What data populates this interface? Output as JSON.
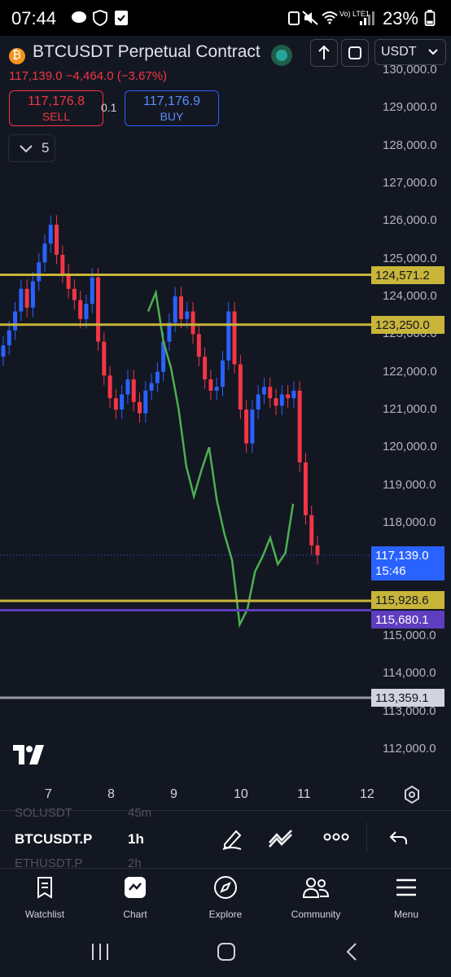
{
  "status_bar": {
    "time": "07:44",
    "battery": "23%",
    "network": "Vo) LTE1"
  },
  "header": {
    "symbol_title": "BTCUSDT Perpetual Contract",
    "currency": "USDT",
    "price_change": "117,139.0  −4,464.0 (−3.67%)"
  },
  "trade": {
    "sell_price": "117,176.8",
    "sell_label": "SELL",
    "spread": "0.1",
    "buy_price": "117,176.9",
    "buy_label": "BUY"
  },
  "indicator_toggle": {
    "count": "5"
  },
  "chart_data": {
    "type": "candlestick",
    "x_labels": [
      "7",
      "8",
      "9",
      "10",
      "11",
      "12"
    ],
    "y_ticks": [
      "130,000.0",
      "129,000.0",
      "128,000.0",
      "127,000.0",
      "126,000.0",
      "125,000.0",
      "124,000.0",
      "123,000.0",
      "122,000.0",
      "121,000.0",
      "120,000.0",
      "119,000.0",
      "118,000.0",
      "117,000.0",
      "116,000.0",
      "115,000.0",
      "114,000.0",
      "113,000.0",
      "112,000.0"
    ],
    "ylim": [
      111500,
      130500
    ],
    "price_lines": [
      {
        "value": 124571.2,
        "label": "124,571.2",
        "color": "#c8b53a"
      },
      {
        "value": 123250.0,
        "label": "123,250.0",
        "color": "#c8b53a"
      },
      {
        "value": 115928.6,
        "label": "115,928.6",
        "color": "#c8b53a"
      },
      {
        "value": 115680.1,
        "label": "115,680.1",
        "color": "#5e3dbf"
      },
      {
        "value": 113359.1,
        "label": "113,359.1",
        "color": "#9598a1"
      }
    ],
    "last_price": {
      "value": 117139.0,
      "label": "117,139.0",
      "countdown": "15:46",
      "color": "#2962ff"
    },
    "closes": [
      122700,
      123100,
      123600,
      124200,
      123700,
      124400,
      124900,
      125400,
      125900,
      125100,
      124600,
      124200,
      123900,
      123400,
      123800,
      124500,
      122800,
      121900,
      121300,
      121000,
      121400,
      121800,
      121200,
      120900,
      121500,
      121700,
      122000,
      122800,
      123300,
      124000,
      123400,
      123600,
      123000,
      122400,
      121800,
      121500,
      121600,
      122300,
      123600,
      122200,
      121000,
      120100,
      121000,
      121400,
      121600,
      121300,
      121100,
      121400,
      121300,
      121500,
      119600,
      118200,
      117400,
      117139
    ],
    "oscillator": [
      123600,
      124100,
      122800,
      122100,
      121000,
      119500,
      118700,
      119400,
      120000,
      118600,
      117700,
      117000,
      115300,
      115700,
      116700,
      117100,
      117600,
      116900,
      117200,
      118500
    ],
    "colors": {
      "up": "#2962ff",
      "down": "#f23645",
      "oscillator": "#4caf50"
    }
  },
  "toolbar": {
    "watchlist_prev": "SOLUSDT",
    "watchlist_prev_interval": "45m",
    "symbol": "BTCUSDT.P",
    "interval": "1h",
    "watchlist_next": "ETHUSDT.P",
    "watchlist_next_interval": "2h"
  },
  "tabs": [
    {
      "label": "Watchlist",
      "icon": "watchlist-icon"
    },
    {
      "label": "Chart",
      "icon": "chart-icon"
    },
    {
      "label": "Explore",
      "icon": "compass-icon"
    },
    {
      "label": "Community",
      "icon": "community-icon"
    },
    {
      "label": "Menu",
      "icon": "menu-icon"
    }
  ]
}
